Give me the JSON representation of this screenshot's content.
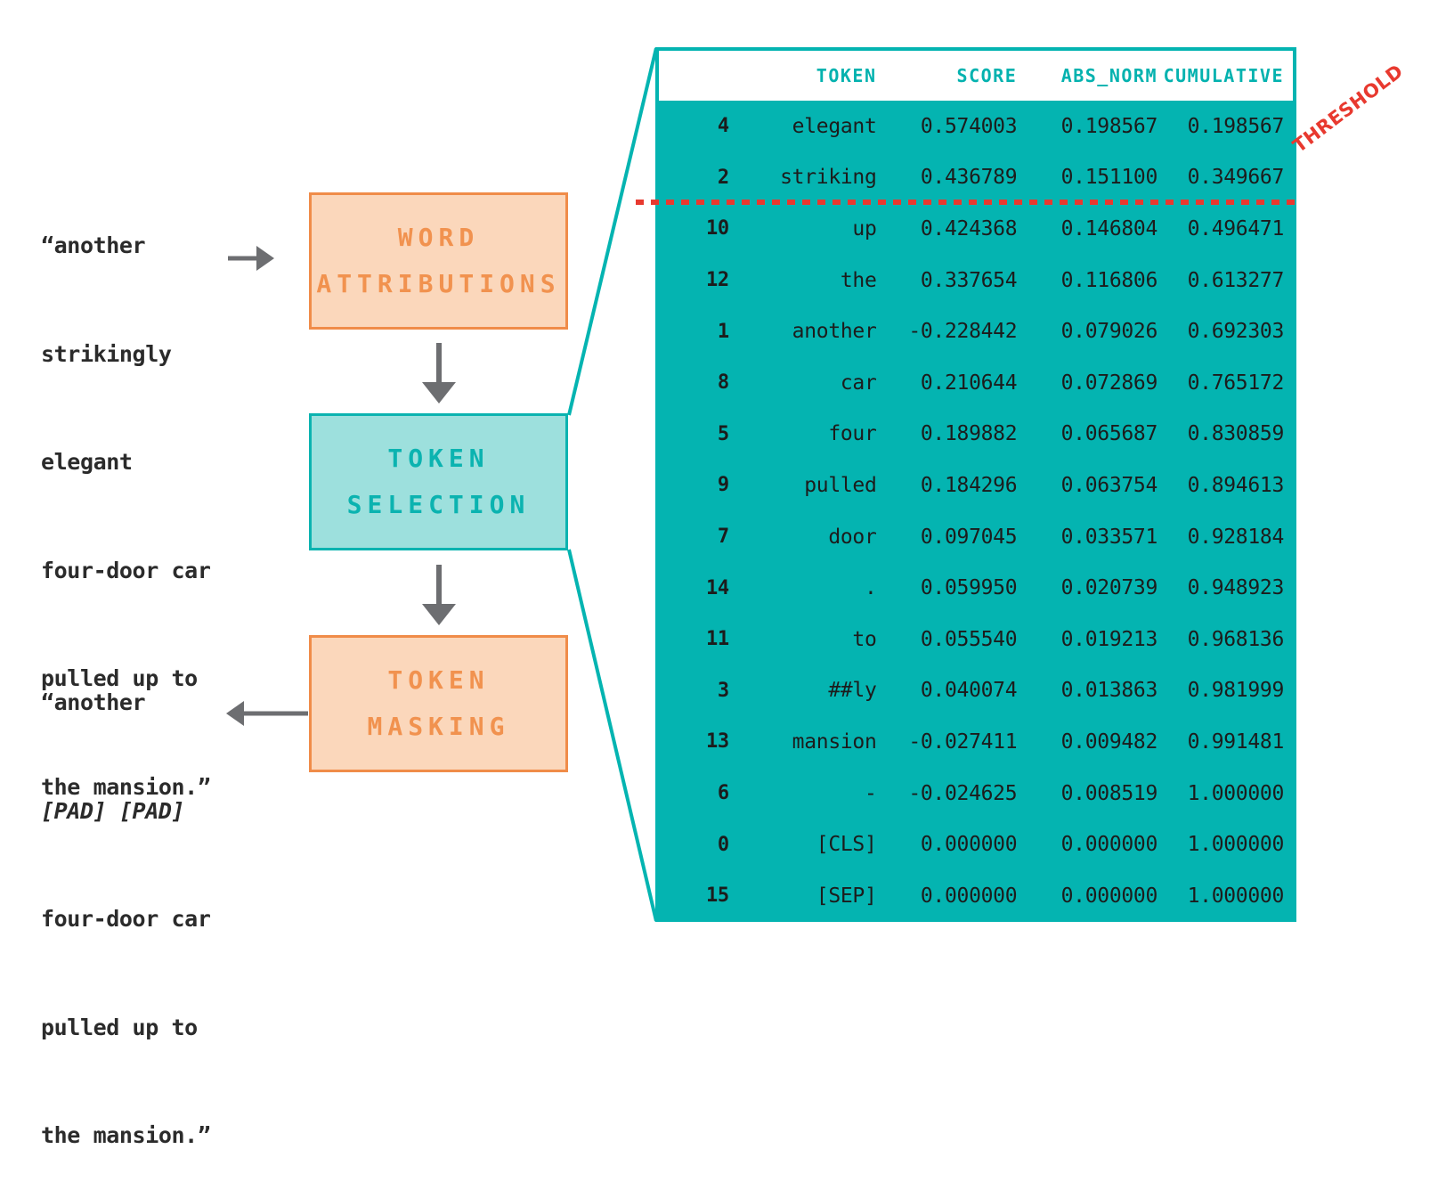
{
  "input_text": {
    "label": "original-sentence",
    "lines": [
      "“another",
      "strikingly",
      "elegant",
      "four-door car",
      "pulled up to",
      "the mansion.”"
    ]
  },
  "output_text": {
    "label": "masked-sentence",
    "lines": [
      "“another",
      "[PAD] [PAD]",
      "four-door car",
      "pulled up to",
      "the mansion.”"
    ],
    "pad_line_index": 1
  },
  "pipeline": {
    "steps": [
      {
        "id": "word-attributions",
        "line1": "WORD",
        "line2": "ATTRIBUTIONS",
        "fill": "#fbd7bb",
        "stroke": "#f08c49",
        "text_color": "#f1924f"
      },
      {
        "id": "token-selection",
        "line1": "TOKEN",
        "line2": "SELECTION",
        "fill": "#9de0dd",
        "stroke": "#0bb3b0",
        "text_color": "#0bb3b0"
      },
      {
        "id": "token-masking",
        "line1": "TOKEN",
        "line2": "MASKING",
        "fill": "#fbd7bb",
        "stroke": "#f08c49",
        "text_color": "#f1924f"
      }
    ]
  },
  "threshold": {
    "label": "THRESHOLD",
    "color": "#e8392f",
    "after_row_index": 1
  },
  "colors": {
    "teal": "#04b4b1",
    "teal_light": "#9de0dd",
    "orange": "#f08c49",
    "orange_light": "#fbd7bb",
    "red": "#e8392f",
    "arrow_gray": "#6d6e71",
    "text_dark": "#1c1c1c"
  },
  "chart_data": {
    "type": "table",
    "title": "",
    "columns": [
      "",
      "TOKEN",
      "SCORE",
      "ABS_NORM",
      "CUMULATIVE"
    ],
    "rows": [
      [
        "4",
        "elegant",
        "0.574003",
        "0.198567",
        "0.198567"
      ],
      [
        "2",
        "striking",
        "0.436789",
        "0.151100",
        "0.349667"
      ],
      [
        "10",
        "up",
        "0.424368",
        "0.146804",
        "0.496471"
      ],
      [
        "12",
        "the",
        "0.337654",
        "0.116806",
        "0.613277"
      ],
      [
        "1",
        "another",
        "-0.228442",
        "0.079026",
        "0.692303"
      ],
      [
        "8",
        "car",
        "0.210644",
        "0.072869",
        "0.765172"
      ],
      [
        "5",
        "four",
        "0.189882",
        "0.065687",
        "0.830859"
      ],
      [
        "9",
        "pulled",
        "0.184296",
        "0.063754",
        "0.894613"
      ],
      [
        "7",
        "door",
        "0.097045",
        "0.033571",
        "0.928184"
      ],
      [
        "14",
        ".",
        "0.059950",
        "0.020739",
        "0.948923"
      ],
      [
        "11",
        "to",
        "0.055540",
        "0.019213",
        "0.968136"
      ],
      [
        "3",
        "##ly",
        "0.040074",
        "0.013863",
        "0.981999"
      ],
      [
        "13",
        "mansion",
        "-0.027411",
        "0.009482",
        "0.991481"
      ],
      [
        "6",
        "-",
        "-0.024625",
        "0.008519",
        "1.000000"
      ],
      [
        "0",
        "[CLS]",
        "0.000000",
        "0.000000",
        "1.000000"
      ],
      [
        "15",
        "[SEP]",
        "0.000000",
        "0.000000",
        "1.000000"
      ]
    ]
  }
}
